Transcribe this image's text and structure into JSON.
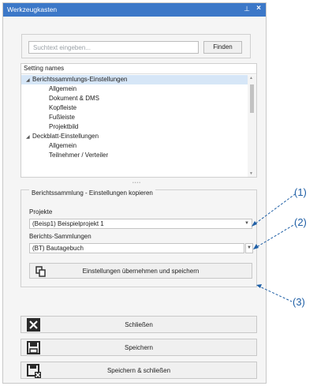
{
  "window": {
    "title": "Werkzeugkasten",
    "pin_glyph": "⊥",
    "close_glyph": "×"
  },
  "search": {
    "placeholder": "Suchtext eingeben...",
    "value": "",
    "find_label": "Finden"
  },
  "tree": {
    "header": "Setting names",
    "rows": [
      {
        "label": "Berichtssammlungs-Einstellungen",
        "expander": "◢",
        "selected": true
      },
      {
        "label": "Allgemein"
      },
      {
        "label": "Dokument & DMS"
      },
      {
        "label": "Kopfleiste"
      },
      {
        "label": "Fußleiste"
      },
      {
        "label": "Projektbild"
      },
      {
        "label": "Deckblatt-Einstellungen",
        "expander": "◢"
      },
      {
        "label": "Allgemein"
      },
      {
        "label": "Teilnehmer / Verteiler"
      }
    ]
  },
  "copy_settings": {
    "group_title": "Berichtssammlung - Einstellungen kopieren",
    "project_label": "Projekte",
    "project_value": "(Beisp1) Beispielprojekt 1",
    "collection_label": "Berichts-Sammlungen",
    "collection_value": "(BT) Bautagebuch",
    "apply_label": "Einstellungen übernehmen und speichern"
  },
  "actions": {
    "close_label": "Schließen",
    "save_label": "Speichern",
    "save_close_label": "Speichern & schließen"
  },
  "callouts": {
    "c1": "(1)",
    "c2": "(2)",
    "c3": "(3)"
  },
  "colors": {
    "titlebar": "#3c78c8",
    "callout": "#1f5fa6",
    "selection": "#d6e6f7"
  }
}
